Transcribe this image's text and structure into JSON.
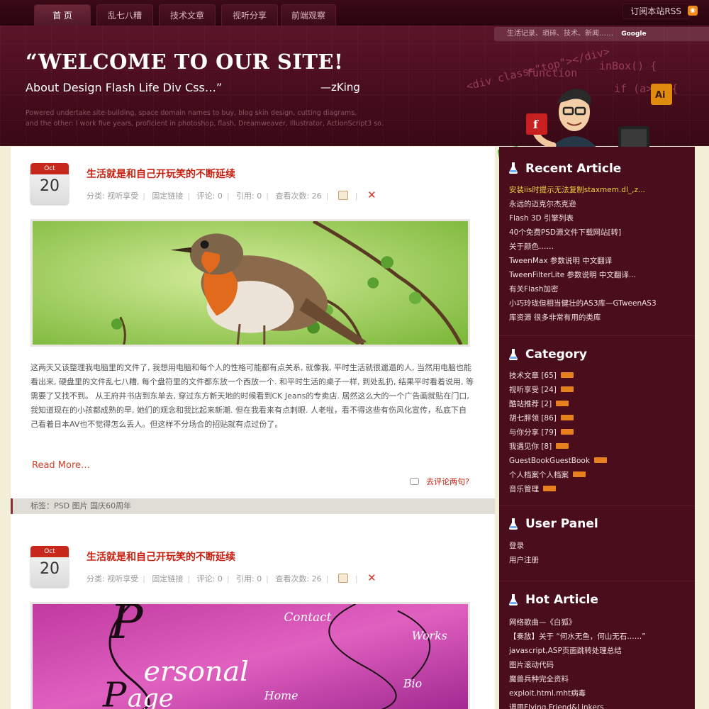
{
  "nav": {
    "tabs": [
      "首 页",
      "乱七八糟",
      "技术文章",
      "视听分享",
      "前端观察"
    ],
    "active_index": 0,
    "rss_label": "订阅本站RSS"
  },
  "header": {
    "title": "“WELCOME TO OUR SITE!",
    "subtitle": "About Design Flash Life Div Css…”",
    "author": "—zKing",
    "description_line1": "Powered undertake site-building, space domain names to buy, blog skin design, cutting diagrams,",
    "description_line2": "and the other: I work five years, proficient in photoshop, flash, Dreamweaver, Illustrator, ActionScript3 so.",
    "search_placeholder": "生活记录、琐碎、技术、新闻……",
    "search_brand": "Google",
    "code_text_1": "<div class=\"top\"></div>",
    "code_text_2": "function",
    "code_text_3": "inBox() {",
    "code_text_4": "if (a>b) {"
  },
  "posts": [
    {
      "month": "Oct",
      "day": "20",
      "title": "生活就是和自己开玩笑的不断延续",
      "category": "分类: 视听享受",
      "permalink": "固定链接",
      "comments": "评论: 0",
      "trackbacks": "引用: 0",
      "views": "查看次数: 26",
      "body": "这两天又该整理我电脑里的文件了, 我想用电脑和每个人的性格可能都有点关系, 就像我, 平时生活就很邋遢的人, 当然用电脑也能看出来, 硬盘里的文件乱七八糟, 每个盘符里的文件都东放一个西放一个. 和平时生活的桌子一样, 到处乱扔, 结果平时看着说用, 等需要了又找不到。 从王府井书店到东单去, 穿过东方新天地的时候看到CK Jeans的专卖店. 居然这么大的一个广告画就贴在门口, 我知道现在的小孩都成熟的早, 她们的观念和我比起来新潮. 但在我看来有点刺眼. 人老啦，看不得这些有伤风化宣传，私底下自己看着日本AV也不觉得怎么丢人。但这样不分场合的招贴就有点过份了。",
      "read_more": "Read More…",
      "comment_link": "去评论两句?",
      "tags": "标签：PSD 图片 国庆60周年"
    },
    {
      "month": "Oct",
      "day": "20",
      "title": "生活就是和自己开玩笑的不断延续",
      "category": "分类: 视听享受",
      "permalink": "固定链接",
      "comments": "评论: 0",
      "trackbacks": "引用: 0",
      "views": "查看次数: 26",
      "image_text_contact": "Contact",
      "image_text_works": "Works",
      "image_text_bio": "Bio",
      "image_text_home": "Home",
      "image_text_personal": "ersonal",
      "image_text_page": "age"
    }
  ],
  "sidebar": {
    "recent": {
      "title": "Recent Article",
      "items": [
        "安装iis时提示无法复制staxmem.dl_,z...",
        "永远的迈克尔杰克逊",
        "Flash 3D 引擎列表",
        "40个免费PSD源文件下载网站[转]",
        "关于颜色……",
        "TweenMax 参数说明 中文翻译",
        "TweenFilterLite 参数说明 中文翻译...",
        "有关Flash加密",
        "小巧玲珑但相当健壮的AS3库—GTweenAS3",
        "库资源 很多非常有用的类库"
      ]
    },
    "category": {
      "title": "Category",
      "items": [
        "技术文章 [65]",
        "视听享受 [24]",
        "酷站推荐 [2]",
        "胡七胖领 [86]",
        "与你分享 [79]",
        "我遇见你 [8]",
        "GuestBookGuestBook",
        "个人档案个人档案",
        "音乐管理"
      ]
    },
    "user": {
      "title": "User Panel",
      "items": [
        "登录",
        "用户注册"
      ]
    },
    "hot": {
      "title": "Hot Article",
      "items": [
        "网络歌曲—《白狐》",
        "【奏敌】关于 “何水无鱼，何山无石……”",
        "javascript,ASP页面跳转处理总结",
        "图片滚动代码",
        "魔兽兵种完全资料",
        "exploit.html.mht病毒",
        "调用Flying.Friend&Linkers"
      ]
    }
  },
  "colors": {
    "accent_red": "#c82010",
    "sidebar_bg": "#4a0d1c",
    "header_bg": "#5c1528",
    "highlight_yellow": "#f0d040"
  }
}
